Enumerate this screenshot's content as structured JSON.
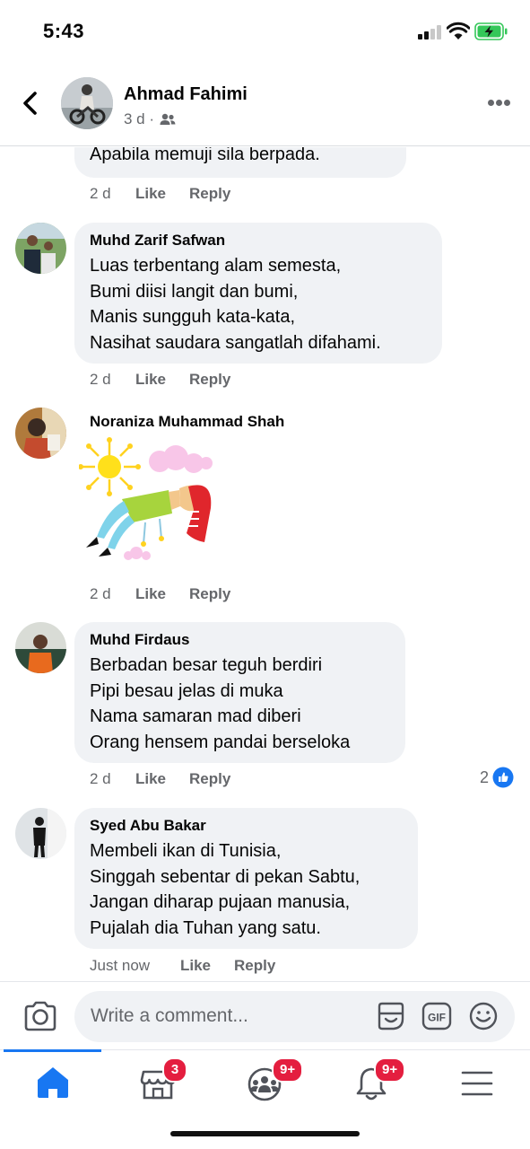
{
  "status_bar": {
    "time": "5:43"
  },
  "header": {
    "author_name": "Ahmad Fahimi",
    "post_age": "3 d ·",
    "audience_icon": "friends-icon",
    "more_icon": "more-horizontal-icon",
    "back_icon": "back-chevron-icon"
  },
  "comments": [
    {
      "lines": [
        "Apabila memuji sila berpada."
      ],
      "time": "2 d",
      "like": "Like",
      "reply": "Reply"
    },
    {
      "author": "Muhd Zarif Safwan",
      "lines": [
        "Luas terbentang alam semesta,",
        "Bumi diisi langit dan bumi,",
        "Manis sungguh kata-kata,",
        "Nasihat saudara sangatlah difahami."
      ],
      "time": "2 d",
      "like": "Like",
      "reply": "Reply"
    },
    {
      "author": "Noraniza Muhammad Shah",
      "sticker": "sun-and-flying-girl-sticker",
      "time": "2 d",
      "like": "Like",
      "reply": "Reply"
    },
    {
      "author": "Muhd Firdaus",
      "lines": [
        "Berbadan besar teguh berdiri",
        "Pipi besau jelas di muka",
        "Nama samaran mad diberi",
        "Orang hensem pandai berseloka"
      ],
      "time": "2 d",
      "like": "Like",
      "reply": "Reply",
      "reaction_count": "2",
      "reaction_icon": "thumbs-up-icon"
    },
    {
      "author": "Syed Abu Bakar",
      "lines": [
        "Membeli ikan di Tunisia,",
        "Singgah sebentar di pekan Sabtu,",
        "Jangan diharap pujaan manusia,",
        "Pujalah dia Tuhan yang satu."
      ],
      "time": "Just now",
      "like": "Like",
      "reply": "Reply"
    }
  ],
  "composer": {
    "placeholder": "Write a comment...",
    "icons": [
      "camera-icon",
      "sticker-icon",
      "gif-icon",
      "emoji-icon"
    ]
  },
  "tabbar": {
    "tabs": [
      {
        "name": "home",
        "icon": "home-icon",
        "active": true
      },
      {
        "name": "marketplace",
        "icon": "marketplace-icon",
        "badge": "3"
      },
      {
        "name": "groups",
        "icon": "groups-icon",
        "badge": "9+"
      },
      {
        "name": "notifications",
        "icon": "bell-icon",
        "badge": "9+"
      },
      {
        "name": "menu",
        "icon": "menu-icon"
      }
    ]
  },
  "colors": {
    "accent": "#1877f2",
    "bubble": "#f0f2f5",
    "secondary_text": "#65676b",
    "badge": "#e41e3f",
    "battery_charging": "#34c759"
  }
}
